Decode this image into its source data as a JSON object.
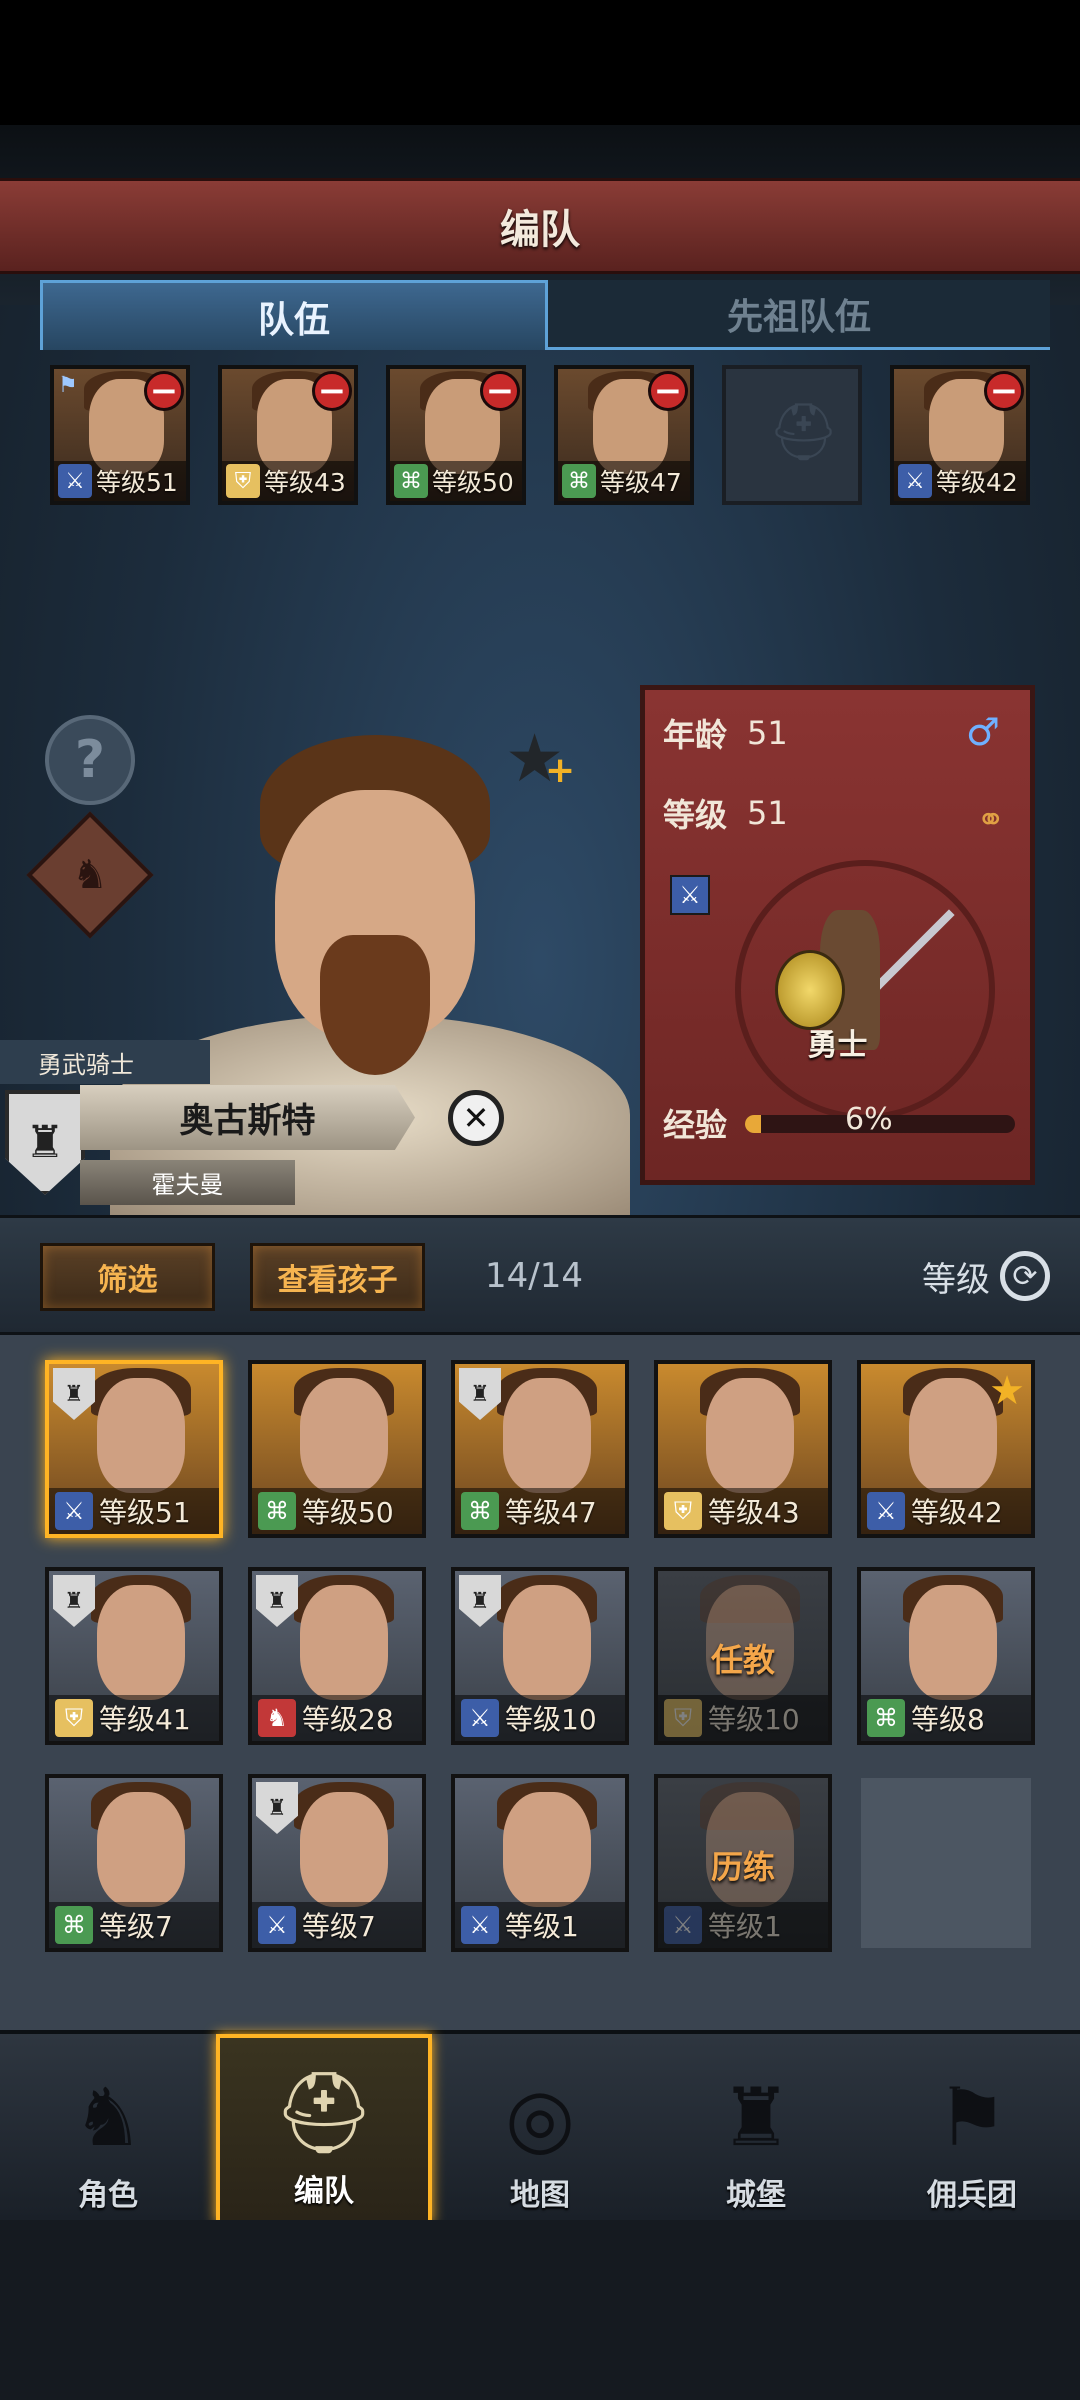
{
  "header": {
    "title": "编队"
  },
  "tabs": [
    {
      "label": "队伍",
      "active": true
    },
    {
      "label": "先祖队伍",
      "active": false
    }
  ],
  "team": [
    {
      "level": "等级51",
      "class": "sword",
      "flag": true,
      "removable": true
    },
    {
      "level": "等级43",
      "class": "shield",
      "flag": false,
      "removable": true
    },
    {
      "level": "等级50",
      "class": "bow",
      "flag": false,
      "removable": true
    },
    {
      "level": "等级47",
      "class": "bow",
      "flag": false,
      "removable": true
    },
    {
      "empty": true
    },
    {
      "level": "等级42",
      "class": "sword",
      "flag": false,
      "removable": true
    }
  ],
  "hero": {
    "title": "勇武骑士",
    "name": "奥古斯特",
    "surname": "霍夫曼"
  },
  "stats": {
    "age_label": "年龄",
    "age_value": "51",
    "level_label": "等级",
    "level_value": "51",
    "gender_icon": "male-icon",
    "married_icon": "rings-icon",
    "class_name": "勇士",
    "exp_label": "经验",
    "exp_value": "6%",
    "exp_fraction": 0.06
  },
  "filter": {
    "filter_label": "筛选",
    "children_label": "查看孩子",
    "count": "14/14",
    "sort_label": "等级"
  },
  "roster": [
    {
      "level": "等级51",
      "class": "sword",
      "selected": true,
      "badge": true
    },
    {
      "level": "等级50",
      "class": "bow"
    },
    {
      "level": "等级47",
      "class": "bow",
      "badge": true
    },
    {
      "level": "等级43",
      "class": "shield"
    },
    {
      "level": "等级42",
      "class": "sword",
      "star": true
    },
    {
      "level": "等级41",
      "class": "shield",
      "grey": true,
      "badge": true
    },
    {
      "level": "等级28",
      "class": "horse",
      "grey": true,
      "badge": true
    },
    {
      "level": "等级10",
      "class": "sword",
      "grey": true,
      "badge": true
    },
    {
      "level": "等级10",
      "class": "shield",
      "dim": true,
      "status": "任教"
    },
    {
      "level": "等级8",
      "class": "bow",
      "grey": true
    },
    {
      "level": "等级7",
      "class": "bow",
      "grey": true
    },
    {
      "level": "等级7",
      "class": "sword",
      "grey": true,
      "badge": true
    },
    {
      "level": "等级1",
      "class": "sword",
      "grey": true
    },
    {
      "level": "等级1",
      "class": "sword",
      "dim": true,
      "status": "历练"
    },
    {
      "empty": true
    }
  ],
  "nav": [
    {
      "label": "角色",
      "icon": "knight-icon",
      "active": false
    },
    {
      "label": "编队",
      "icon": "helmet-icon",
      "active": true
    },
    {
      "label": "地图",
      "icon": "compass-icon",
      "active": false
    },
    {
      "label": "城堡",
      "icon": "castle-icon",
      "active": false
    },
    {
      "label": "佣兵团",
      "icon": "mercenary-icon",
      "active": false
    }
  ],
  "colors": {
    "accent": "#ffb424",
    "banner": "#8a3c36",
    "tab_active": "#3e6890"
  }
}
